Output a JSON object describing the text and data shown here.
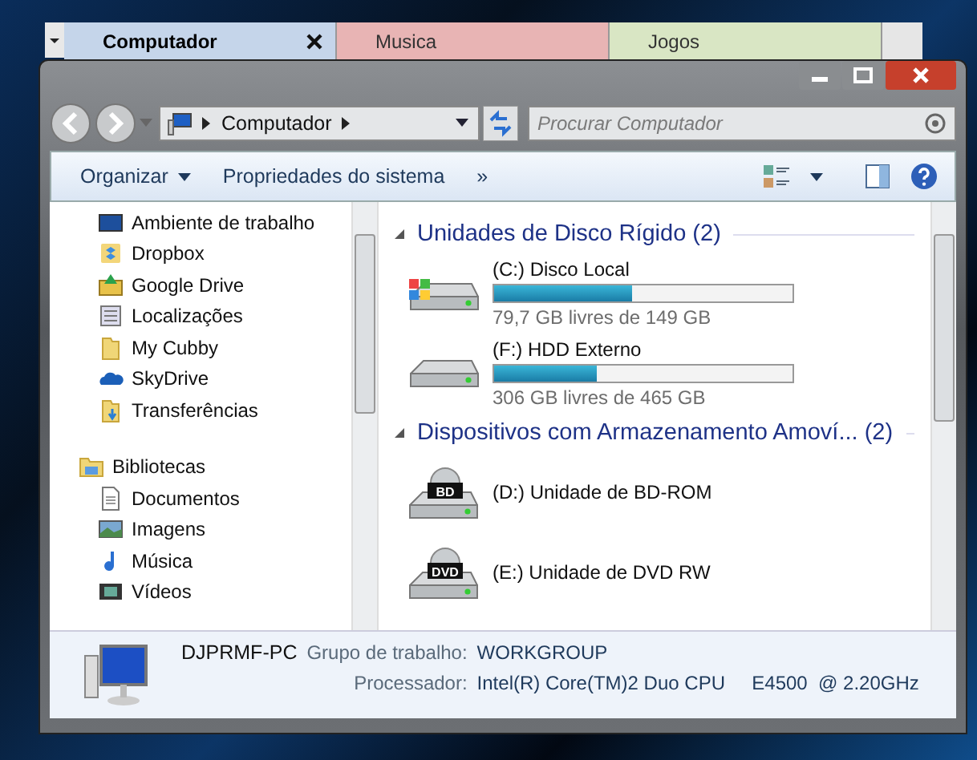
{
  "tabs": [
    {
      "label": "Computador",
      "selected": true,
      "color": "#c5d5ea"
    },
    {
      "label": "Musica",
      "selected": false,
      "color": "#e8b4b4"
    },
    {
      "label": "Jogos",
      "selected": false,
      "color": "#d9e6c4"
    }
  ],
  "address": {
    "path": "Computador"
  },
  "search": {
    "placeholder": "Procurar Computador"
  },
  "commands": [
    "Organizar",
    "Propriedades do sistema"
  ],
  "command_overflow": "»",
  "nav_pane": {
    "items": [
      {
        "label": "Ambiente de trabalho",
        "kind": "desktop"
      },
      {
        "label": "Dropbox",
        "kind": "dropbox"
      },
      {
        "label": "Google Drive",
        "kind": "gdrive"
      },
      {
        "label": "Localizações",
        "kind": "places"
      },
      {
        "label": "My Cubby",
        "kind": "folder"
      },
      {
        "label": "SkyDrive",
        "kind": "cloud"
      },
      {
        "label": "Transferências",
        "kind": "download"
      }
    ],
    "libraries": {
      "label": "Bibliotecas",
      "children": [
        {
          "label": "Documentos",
          "kind": "document"
        },
        {
          "label": "Imagens",
          "kind": "picture"
        },
        {
          "label": "Música",
          "kind": "music"
        },
        {
          "label": "Vídeos",
          "kind": "video"
        }
      ]
    }
  },
  "sections": [
    {
      "title": "Unidades de Disco Rígido (2)",
      "expanded": true,
      "items": [
        {
          "name": "(C:) Disco Local",
          "kind": "system_disk",
          "level": 0.465,
          "reading": "79,7 GB livres de 149 GB"
        },
        {
          "name": "(F:) HDD Externo",
          "kind": "disk",
          "level": 0.342,
          "reading": "306 GB livres de 465 GB"
        }
      ]
    },
    {
      "title": "Dispositivos com Armazenamento Amoví... (2)",
      "expanded": true,
      "items": [
        {
          "name": "(D:) Unidade de BD-ROM",
          "kind": "optical",
          "disc_label": "BD"
        },
        {
          "name": "(E:) Unidade de DVD RW",
          "kind": "optical",
          "disc_label": "DVD"
        }
      ]
    }
  ],
  "details": {
    "computer_name": "DJPRMF-PC",
    "rows": [
      {
        "label": "Grupo de trabalho:",
        "value": "WORKGROUP"
      },
      {
        "label": "Processador:",
        "value": "Intel(R) Core(TM)2 Duo CPU     E4500  @ 2.20GHz"
      }
    ]
  }
}
